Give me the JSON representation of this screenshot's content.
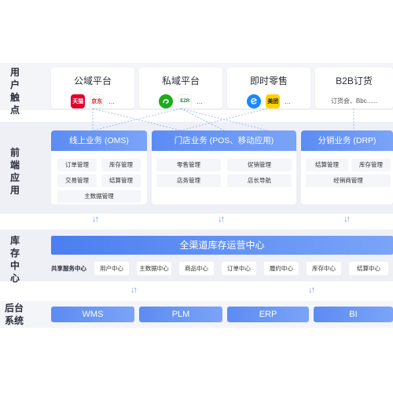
{
  "sections": {
    "touchpoints": "用户触点",
    "frontend": "前端应用",
    "inventory": "库存中心",
    "backend": "后台系统"
  },
  "touchpoints": [
    {
      "title": "公域平台",
      "apps": [
        {
          "label": "天猫",
          "color": "#e4002b"
        },
        {
          "label": "京东",
          "color": "#d7261b"
        }
      ],
      "more": "..."
    },
    {
      "title": "私域平台",
      "apps": [
        {
          "label": "小程序",
          "color": "#1aad19"
        },
        {
          "label": "EZR",
          "color": "#ffffff"
        }
      ],
      "more": "..."
    },
    {
      "title": "即时零售",
      "apps": [
        {
          "label": "饿了么",
          "color": "#1689ff"
        },
        {
          "label": "美团",
          "color": "#ffd100"
        }
      ],
      "more": "..."
    },
    {
      "title": "B2B订货",
      "text": "订货会、Bbc......"
    }
  ],
  "frontend_blocks": [
    {
      "title": "线上业务 (OMS)",
      "items": [
        "订单管理",
        "库存管理",
        "交易管理",
        "结算管理",
        "主数据管理"
      ]
    },
    {
      "title": "门店业务 (POS、移动应用)",
      "items": [
        "零售管理",
        "促销管理",
        "店务管理",
        "店长导航"
      ]
    },
    {
      "title": "分销业务 (DRP)",
      "items": [
        "结算管理",
        "库存管理",
        "经销商管理"
      ]
    }
  ],
  "inventory": {
    "title": "全渠道库存运营中心",
    "shared_label": "共享服务中心",
    "services": [
      "用户中心",
      "主数据中心",
      "商品中心",
      "订单中心",
      "履约中心",
      "库存中心",
      "结算中心"
    ]
  },
  "backend_systems": [
    "WMS",
    "PLM",
    "ERP",
    "BI"
  ],
  "arrow_glyph": "↓↑",
  "colors": {
    "accent": "#5c8cf3",
    "band": "#eef0f6"
  }
}
